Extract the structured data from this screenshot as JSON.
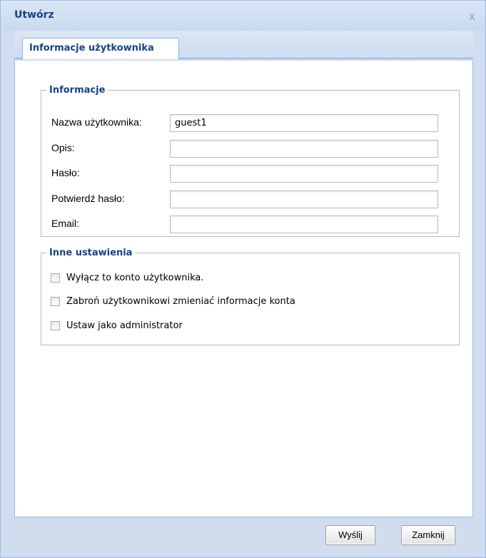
{
  "window": {
    "title": "Utwórz",
    "close_icon": "x"
  },
  "tabs": [
    {
      "label": "Informacje użytkownika",
      "active": true
    }
  ],
  "info_section": {
    "legend": "Informacje",
    "fields": [
      {
        "label": "Nazwa użytkownika:",
        "value": "guest1",
        "placeholder": ""
      },
      {
        "label": "Opis:",
        "value": "",
        "placeholder": ""
      },
      {
        "label": "Hasło:",
        "value": "",
        "placeholder": ""
      },
      {
        "label": "Potwierdź hasło:",
        "value": "",
        "placeholder": ""
      },
      {
        "label": "Email:",
        "value": "",
        "placeholder": ""
      }
    ]
  },
  "other_section": {
    "legend": "Inne ustawienia",
    "checkboxes": [
      {
        "label": "Wyłącz to konto użytkownika.",
        "checked": false
      },
      {
        "label": "Zabroń użytkownikowi zmieniać informacje konta",
        "checked": false
      },
      {
        "label": "Ustaw jako administrator",
        "checked": false
      }
    ]
  },
  "footer": {
    "submit_label": "Wyślij",
    "close_label": "Zamknij"
  },
  "colors": {
    "accent": "#15428b",
    "border": "#99bbe8",
    "window_bg": "#cfddee"
  }
}
